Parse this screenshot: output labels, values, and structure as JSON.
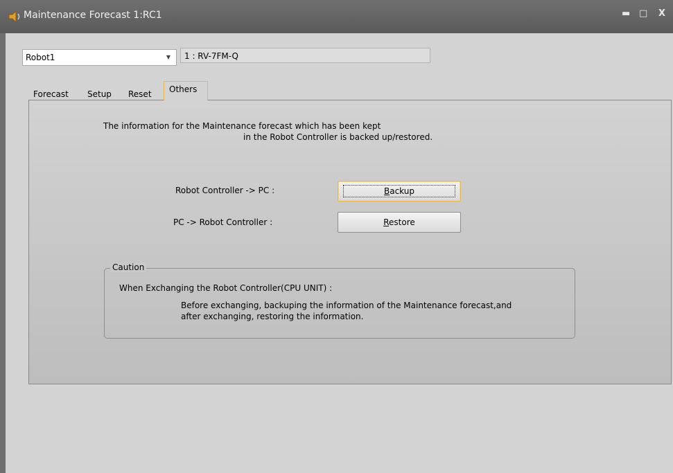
{
  "window": {
    "title": "Maintenance Forecast 1:RC1",
    "icon": "speaker-icon",
    "controls": {
      "minimize": "▬",
      "maximize": "□",
      "close": "X"
    }
  },
  "robot_select": {
    "value": "Robot1"
  },
  "model": {
    "value": "1 : RV-7FM-Q"
  },
  "tabs": [
    {
      "label": "Forecast",
      "active": false
    },
    {
      "label": "Setup",
      "active": false
    },
    {
      "label": "Reset",
      "active": false
    },
    {
      "label": "Others",
      "active": true
    }
  ],
  "others": {
    "info_line1": "The information for the Maintenance forecast which has been kept",
    "info_line2": "in the Robot Controller is backed up/restored.",
    "backup_label": "Robot Controller -> PC :",
    "backup_button": {
      "mnemonic": "B",
      "rest": "ackup"
    },
    "restore_label": "PC -> Robot Controller :",
    "restore_button": {
      "mnemonic": "R",
      "rest": "estore"
    }
  },
  "caution": {
    "legend": "Caution",
    "heading": "When Exchanging the Robot Controller(CPU UNIT) :",
    "line1": "Before exchanging, backuping the information of the Maintenance forecast,and",
    "line2": "after exchanging, restoring the information."
  },
  "colors": {
    "tab_highlight": "#e2b64c",
    "titlebar": "#5a5a5a"
  }
}
